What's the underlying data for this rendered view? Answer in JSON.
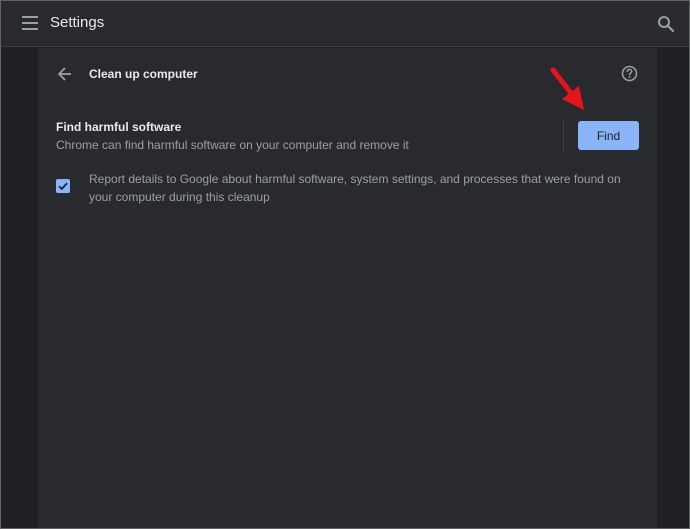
{
  "header": {
    "title": "Settings",
    "menu_icon": "hamburger-menu-icon",
    "search_icon": "search-icon"
  },
  "page": {
    "title": "Clean up computer",
    "back_icon": "arrow-back-icon",
    "help_icon": "help-circle-icon"
  },
  "section": {
    "title": "Find harmful software",
    "description": "Chrome can find harmful software on your computer and remove it",
    "find_label": "Find"
  },
  "report": {
    "checked": true,
    "label": "Report details to Google about harmful software, system settings, and processes that were found on your computer during this cleanup"
  },
  "colors": {
    "background": "#202124",
    "surface": "#292a2d",
    "accent": "#8ab4f8",
    "annotation_arrow": "#e8141b"
  }
}
